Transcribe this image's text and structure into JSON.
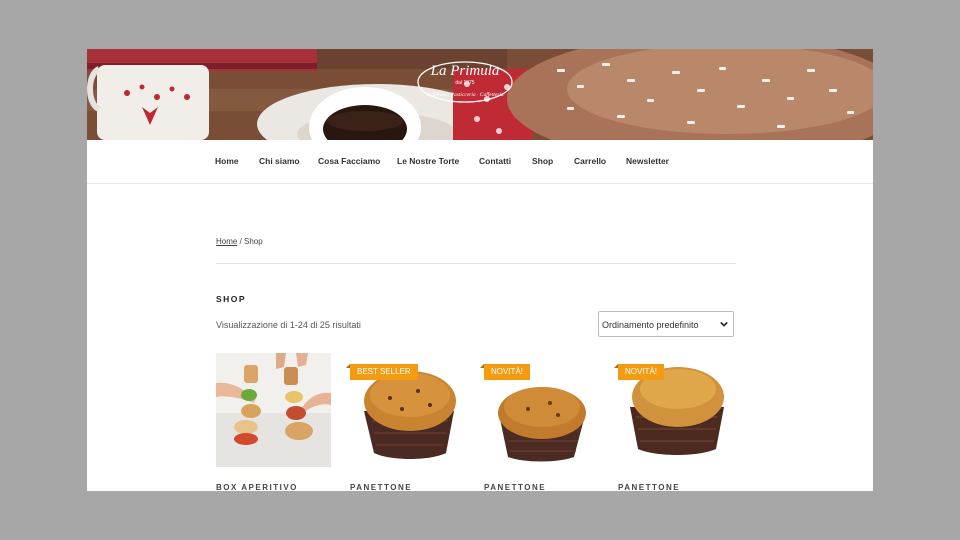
{
  "header": {
    "logo_text": "La Primula",
    "logo_since": "dal 1975",
    "logo_tagline": "Panificio · Pasticceria · Caffetteria"
  },
  "nav": {
    "items": [
      {
        "label": "Home"
      },
      {
        "label": "Chi siamo"
      },
      {
        "label": "Cosa Facciamo"
      },
      {
        "label": "Le Nostre Torte"
      },
      {
        "label": "Contatti"
      },
      {
        "label": "Shop"
      },
      {
        "label": "Carrello"
      },
      {
        "label": "Newsletter"
      }
    ]
  },
  "breadcrumb": {
    "home": "Home",
    "separator": " / ",
    "current": "Shop"
  },
  "shop": {
    "title": "SHOP",
    "result_count": "Visualizzazione di 1-24 di 25 risultati",
    "orderby": {
      "selected": "Ordinamento predefinito"
    }
  },
  "products": [
    {
      "name": "BOX APERITIVO",
      "badge": ""
    },
    {
      "name": "PANETTONE",
      "badge": "BEST SELLER"
    },
    {
      "name": "PANETTONE",
      "badge": "NOVITÀ!"
    },
    {
      "name": "PANETTONE",
      "badge": "NOVITÀ!"
    }
  ],
  "colors": {
    "badge": "#f39c12",
    "page_background": "#a7a7a7",
    "text": "#333333"
  }
}
